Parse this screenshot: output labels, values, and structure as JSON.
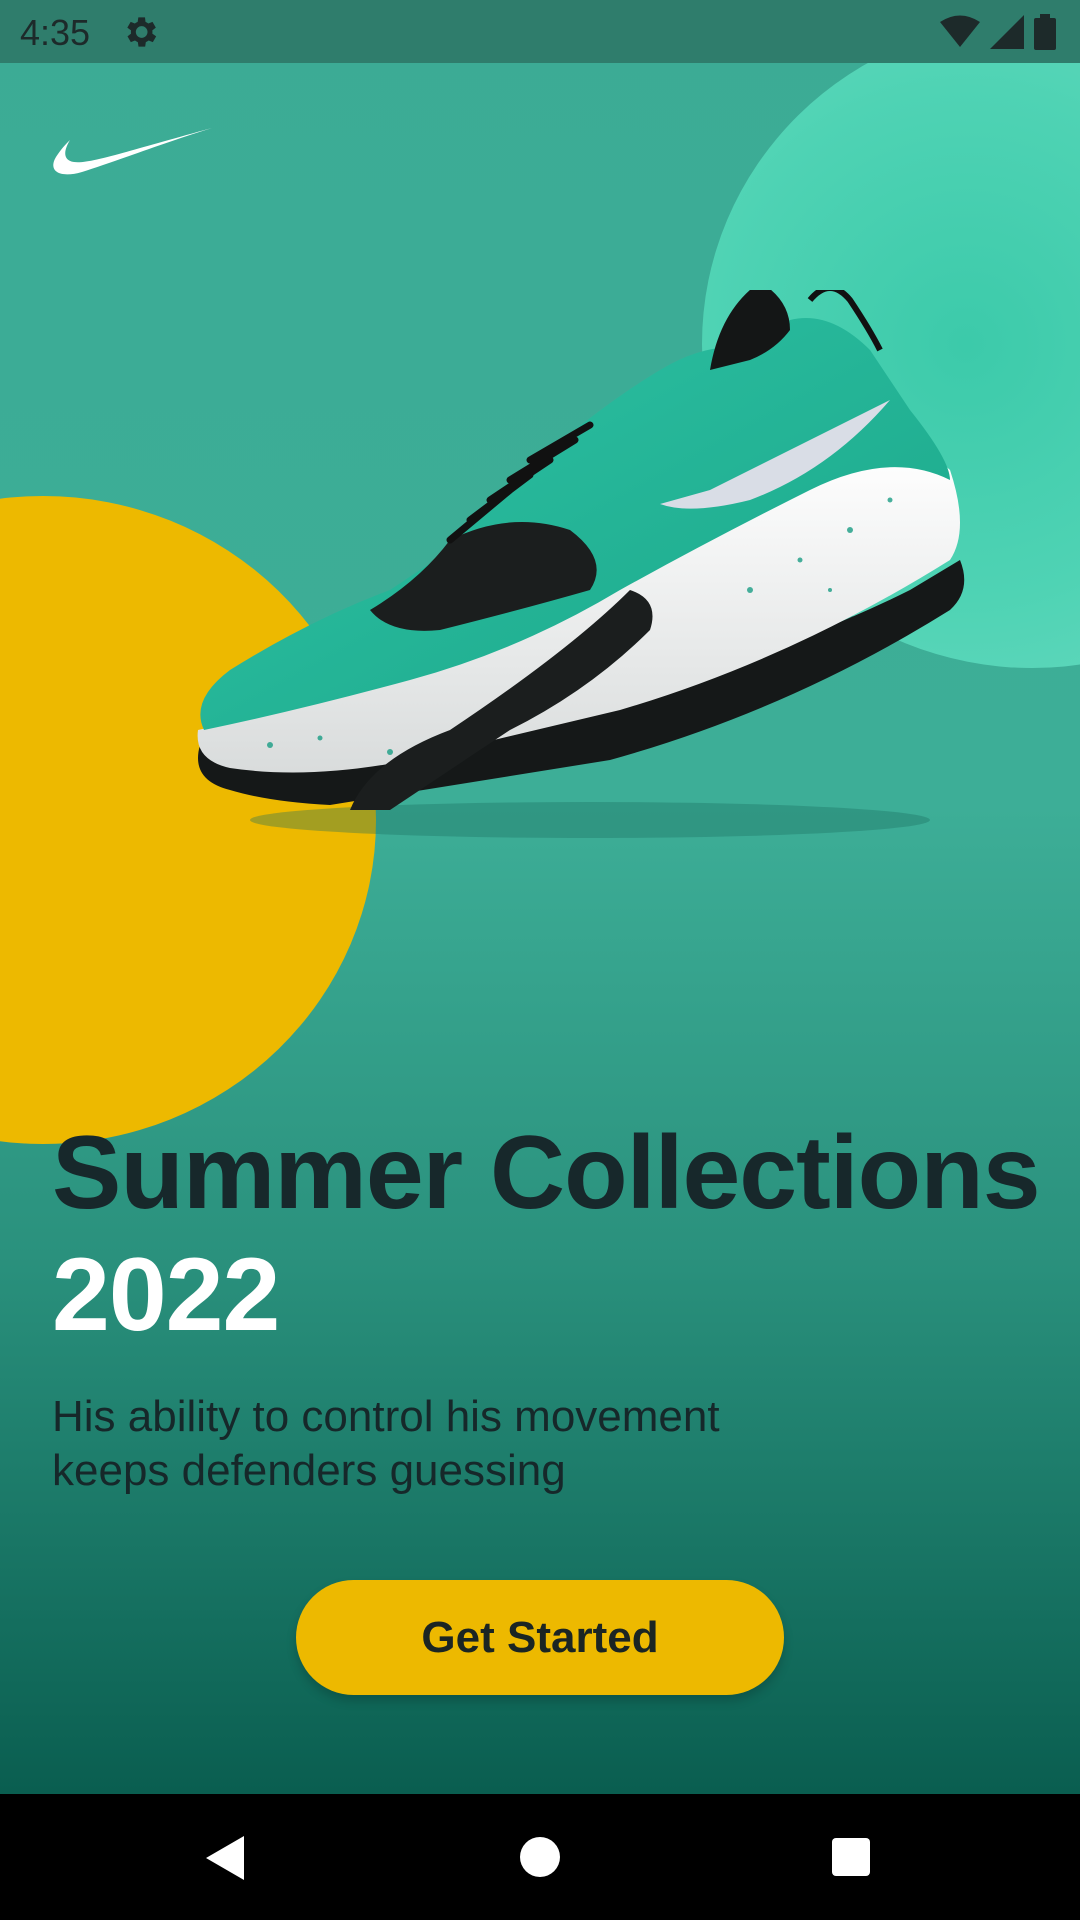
{
  "status_bar": {
    "time": "4:35",
    "icons": [
      "settings-gear-icon",
      "wifi-icon",
      "cell-signal-icon",
      "battery-icon"
    ]
  },
  "brand": {
    "logo": "swoosh-logo"
  },
  "hero": {
    "product_image": "teal-basketball-shoe",
    "headline_line1": "Summer Collections",
    "headline_line2": "2022",
    "subtitle": "His ability to control his movement keeps defenders guessing"
  },
  "cta": {
    "label": "Get Started"
  },
  "nav_bar": {
    "icons": [
      "back-icon",
      "home-icon",
      "recents-icon"
    ]
  },
  "colors": {
    "background_top": "#3cab95",
    "background_bottom": "#0a5e50",
    "accent_yellow": "#edb900",
    "accent_mint": "#4fd3b4",
    "headline_dark": "#17282b",
    "headline_light": "#ffffff"
  }
}
